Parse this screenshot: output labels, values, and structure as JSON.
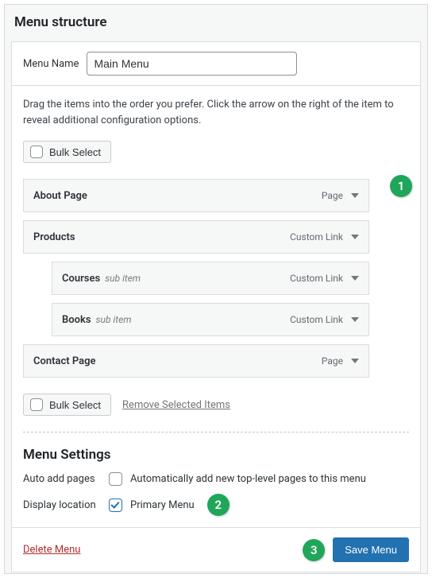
{
  "page_title": "Menu structure",
  "menu_name": {
    "label": "Menu Name",
    "value": "Main Menu"
  },
  "instructions": "Drag the items into the order you prefer. Click the arrow on the right of the item to reveal additional configuration options.",
  "bulk_select_label": "Bulk Select",
  "remove_selected_label": "Remove Selected Items",
  "menu_items": [
    {
      "title": "About Page",
      "type": "Page",
      "sub": false
    },
    {
      "title": "Products",
      "type": "Custom Link",
      "sub": false
    },
    {
      "title": "Courses",
      "type": "Custom Link",
      "sub": true,
      "sub_note": "sub item"
    },
    {
      "title": "Books",
      "type": "Custom Link",
      "sub": true,
      "sub_note": "sub item"
    },
    {
      "title": "Contact Page",
      "type": "Page",
      "sub": false
    }
  ],
  "settings": {
    "title": "Menu Settings",
    "auto_add": {
      "label": "Auto add pages",
      "checkbox_label": "Automatically add new top-level pages to this menu",
      "checked": false
    },
    "display_location": {
      "label": "Display location",
      "checkbox_label": "Primary Menu",
      "checked": true
    }
  },
  "footer": {
    "delete_label": "Delete Menu",
    "save_label": "Save Menu"
  },
  "annotations": {
    "1": "1",
    "2": "2",
    "3": "3"
  }
}
